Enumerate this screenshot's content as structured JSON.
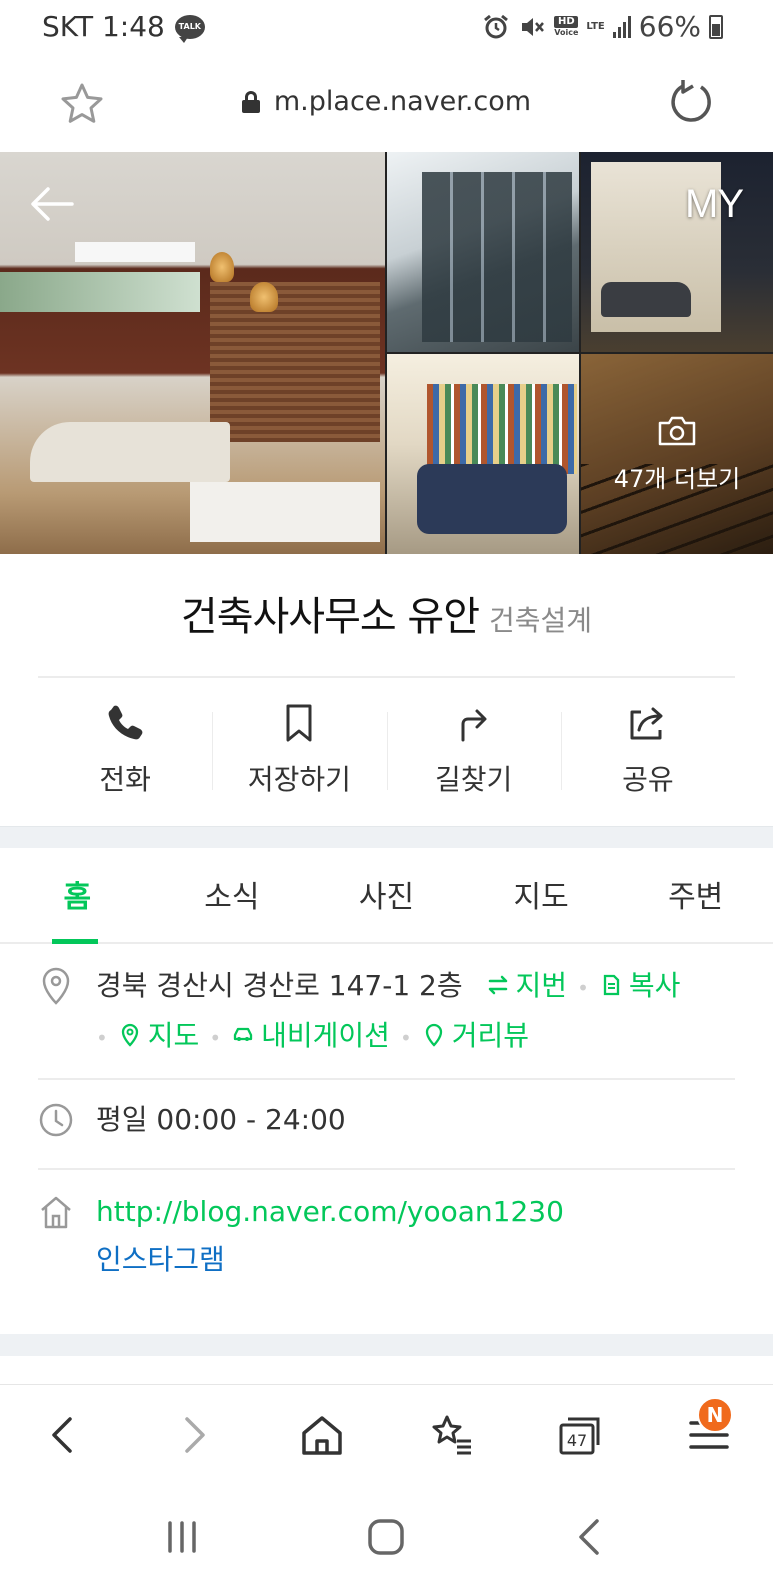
{
  "status_bar": {
    "carrier_time": "SKT 1:48",
    "talk_badge": "TALK",
    "network_hd": "HD",
    "network_voice": "Voice",
    "network_lte": "LTE",
    "battery": "66%"
  },
  "url_bar": {
    "url": "m.place.naver.com",
    "icons": [
      "star-icon",
      "lock-icon",
      "reload-icon"
    ]
  },
  "photos": {
    "my_label": "MY",
    "more_label": "47개 더보기",
    "icons": [
      "back-arrow-icon",
      "camera-icon"
    ]
  },
  "place": {
    "name": "건축사사무소 유안",
    "category": "건축설계"
  },
  "actions": [
    {
      "label": "전화",
      "icon": "phone-icon"
    },
    {
      "label": "저장하기",
      "icon": "bookmark-icon"
    },
    {
      "label": "길찾기",
      "icon": "directions-icon"
    },
    {
      "label": "공유",
      "icon": "share-icon"
    }
  ],
  "tabs": [
    {
      "label": "홈",
      "active": true
    },
    {
      "label": "소식",
      "active": false
    },
    {
      "label": "사진",
      "active": false
    },
    {
      "label": "지도",
      "active": false
    },
    {
      "label": "주변",
      "active": false
    }
  ],
  "info": {
    "address": "경북 경산시 경산로 147-1 2층",
    "address_links": {
      "jibun": "지번",
      "copy": "복사",
      "map": "지도",
      "navigation": "내비게이션",
      "street_view": "거리뷰"
    },
    "hours": "평일 00:00 - 24:00",
    "website": "http://blog.naver.com/yooan1230",
    "instagram": "인스타그램"
  },
  "browser_bar": {
    "tab_count": "47",
    "menu_badge": "N",
    "icons": [
      "back-icon",
      "forward-icon",
      "home-icon",
      "bookmarks-icon",
      "tabs-icon",
      "menu-icon"
    ]
  },
  "colors": {
    "accent_green": "#03c75a",
    "link_blue": "#0f6fc4",
    "badge_orange": "#f06a1c",
    "section_gap": "#eef1f4"
  }
}
